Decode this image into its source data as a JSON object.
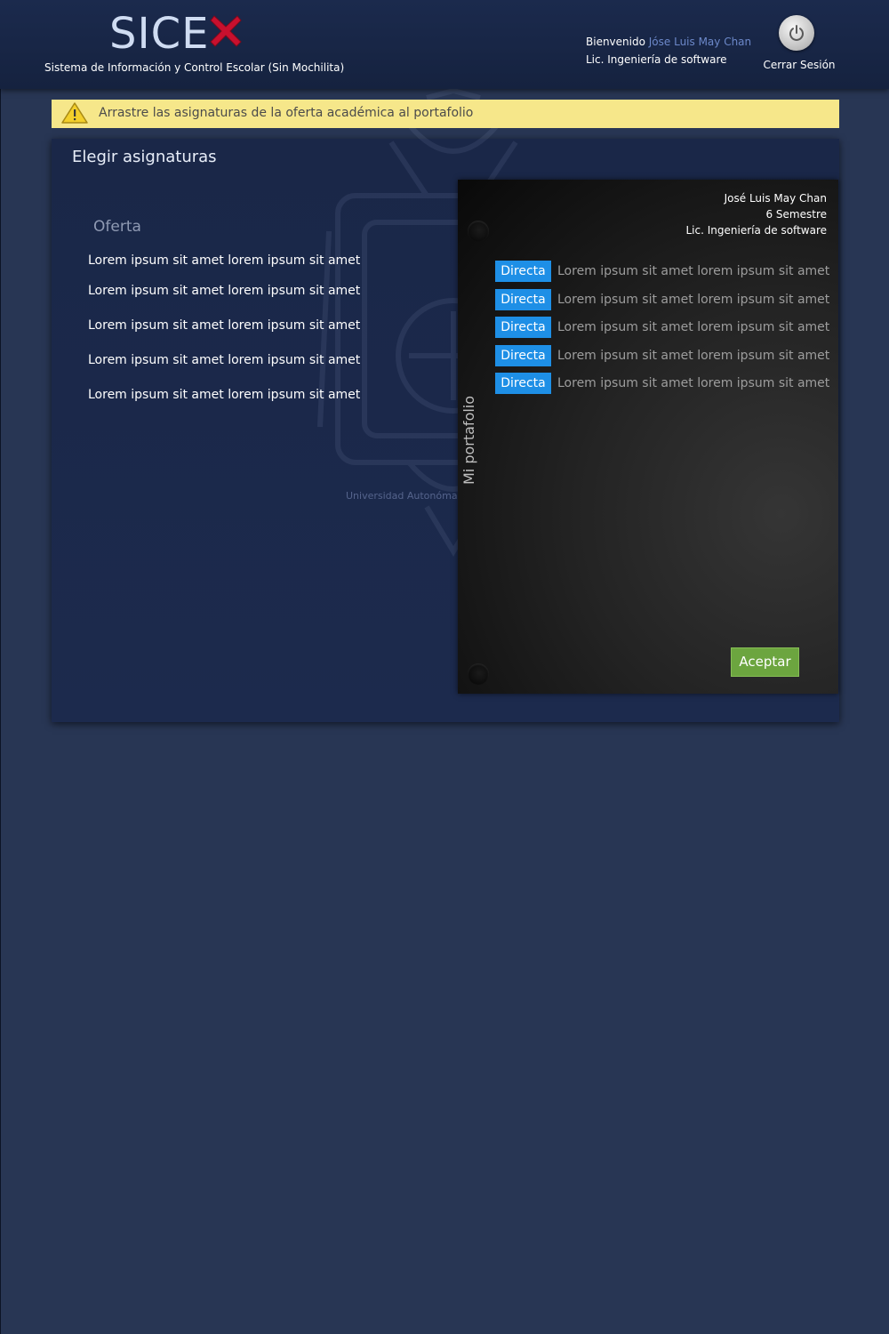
{
  "header": {
    "logo_text": "SICE",
    "subtitle": "Sistema de Información y Control Escolar (Sin Mochilita)",
    "welcome_label": "Bienvenido",
    "user_name": "Jóse Luis May Chan",
    "program": "Lic. Ingeniería de software",
    "logout_label": "Cerrar Sesión"
  },
  "alert": {
    "text": "Arrastre las asignaturas de la oferta académica al portafolio",
    "icon": "warning-icon"
  },
  "panel": {
    "title": "Elegir asignaturas",
    "offer_heading": "Oferta",
    "offer_items": [
      "Lorem ipsum sit amet lorem ipsum sit amet",
      "Lorem ipsum sit amet lorem ipsum sit amet",
      "Lorem ipsum sit amet lorem ipsum sit amet",
      "Lorem ipsum sit amet lorem ipsum sit amet",
      "Lorem ipsum sit amet lorem ipsum sit amet"
    ],
    "watermark_caption": "Universidad Autonóma"
  },
  "portfolio": {
    "label": "Mi portafolio",
    "student": {
      "name": "José Luis May Chan",
      "semester": "6 Semestre",
      "program": "Lic. Ingeniería de software"
    },
    "rows": [
      {
        "badge": "Directa",
        "text": "Lorem ipsum sit amet lorem ipsum sit amet"
      },
      {
        "badge": "Directa",
        "text": "Lorem ipsum sit amet lorem ipsum sit amet"
      },
      {
        "badge": "Directa",
        "text": "Lorem ipsum sit amet lorem ipsum sit amet"
      },
      {
        "badge": "Directa",
        "text": "Lorem ipsum sit amet lorem ipsum sit amet"
      },
      {
        "badge": "Directa",
        "text": "Lorem ipsum sit amet lorem ipsum sit amet"
      }
    ],
    "accept_label": "Aceptar"
  },
  "colors": {
    "background": "#283654",
    "header": "#1b2a4d",
    "alert": "#f6e78a",
    "badge": "#1e8fe6",
    "accept": "#6ca53f",
    "user_link": "#6c88c9",
    "logo_x": "#c8102e"
  },
  "icons": {
    "power": "power-icon",
    "logo_mark": "red-x-icon"
  }
}
